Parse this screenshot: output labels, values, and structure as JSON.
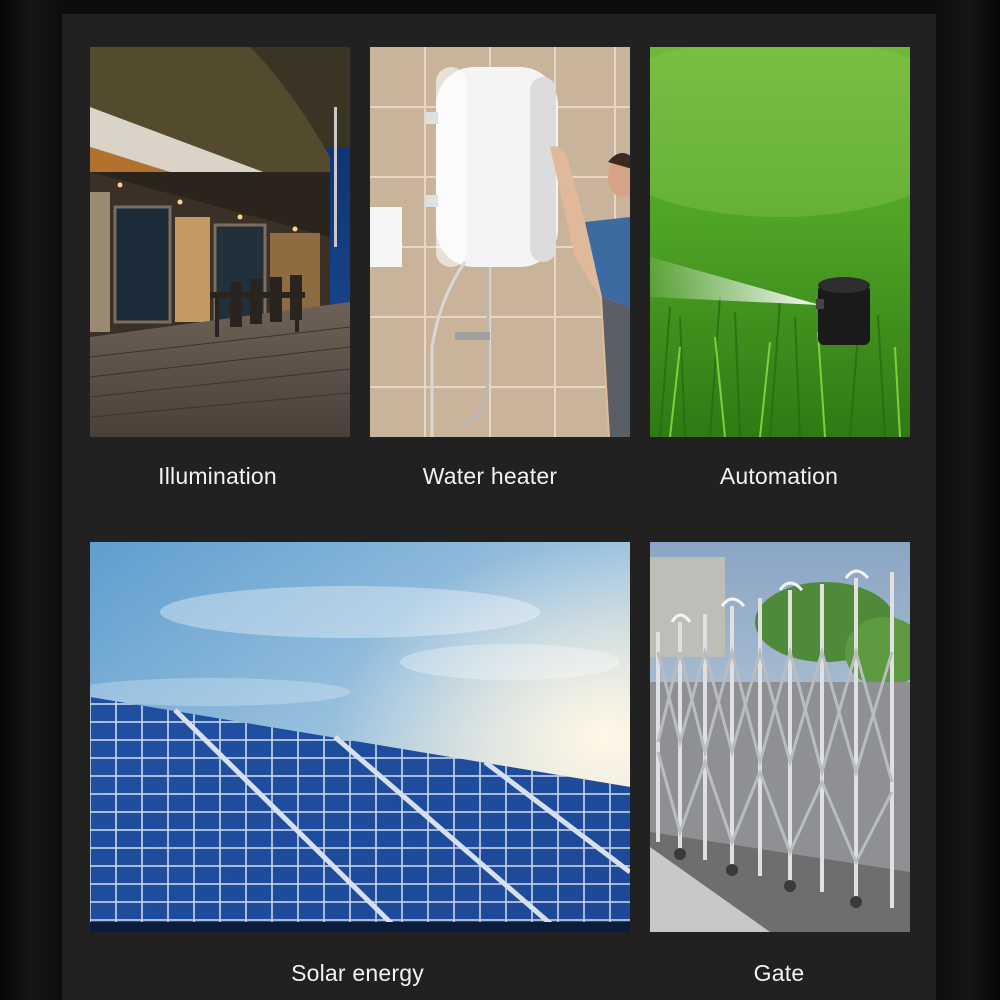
{
  "cards": [
    {
      "caption": "Illumination",
      "image": "patio-at-dusk-image"
    },
    {
      "caption": "Water heater",
      "image": "water-heater-image"
    },
    {
      "caption": "Automation",
      "image": "lawn-sprinkler-image"
    },
    {
      "caption": "Solar energy",
      "image": "solar-panels-image"
    },
    {
      "caption": "Gate",
      "image": "retractable-gate-image"
    }
  ],
  "colors": {
    "page_background": "#0d0d0d",
    "panel_background": "#212121",
    "caption_text": "#f2f2f2"
  }
}
